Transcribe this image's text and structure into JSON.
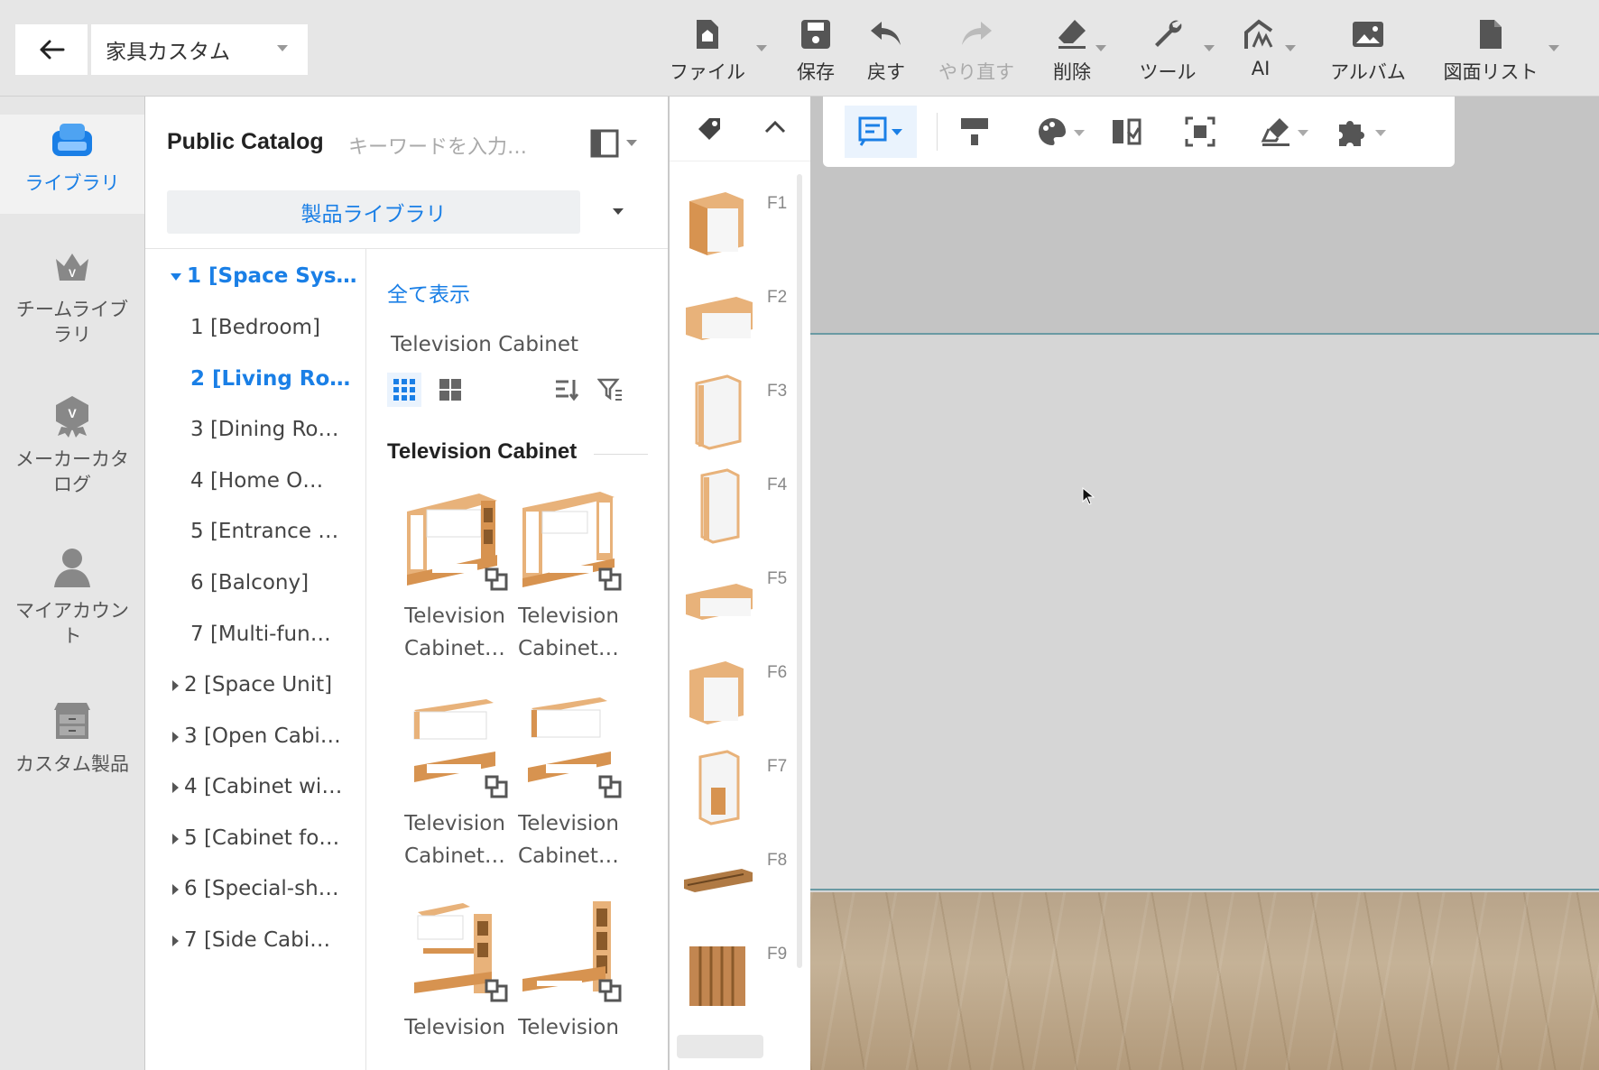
{
  "topbar": {
    "mode": "家具カスタム",
    "tools": [
      {
        "label": "ファイル",
        "icon": "file-icon"
      },
      {
        "label": "保存",
        "icon": "save-icon"
      },
      {
        "label": "戻す",
        "icon": "undo-icon"
      },
      {
        "label": "やり直す",
        "icon": "redo-icon"
      },
      {
        "label": "削除",
        "icon": "eraser-icon"
      },
      {
        "label": "ツール",
        "icon": "wrench-icon"
      },
      {
        "label": "AI",
        "icon": "ai-icon"
      },
      {
        "label": "アルバム",
        "icon": "album-icon"
      },
      {
        "label": "図面リスト",
        "icon": "drawing-list-icon"
      }
    ]
  },
  "rail": {
    "items": [
      {
        "label": "ライブラリ",
        "icon": "sofa-icon"
      },
      {
        "label": "チームライブラリ",
        "icon": "crown-icon"
      },
      {
        "label": "メーカーカタログ",
        "icon": "badge-icon"
      },
      {
        "label": "マイアカウント",
        "icon": "user-icon"
      },
      {
        "label": "カスタム製品",
        "icon": "cabinet-icon"
      }
    ]
  },
  "catalog": {
    "title": "Public Catalog",
    "search_placeholder": "キーワードを入力…",
    "library": "製品ライブラリ",
    "tree": [
      "1 [Space Sys…",
      "1 [Bedroom]",
      "2 [Living Ro…",
      "3 [Dining Ro…",
      "4 [Home O…",
      "5 [Entrance …",
      "6 [Balcony]",
      "7 [Multi-fun…",
      "2 [Space Unit]",
      "3 [Open Cabi…",
      "4 [Cabinet wi…",
      "5 [Cabinet fo…",
      "6 [Special-sh…",
      "7 [Side Cabi…"
    ],
    "show_all": "全て表示",
    "breadcrumb": "Television Cabinet",
    "section_title": "Television Cabinet",
    "products": [
      {
        "line1": "Television",
        "line2": "Cabinet…"
      },
      {
        "line1": "Television",
        "line2": "Cabinet…"
      },
      {
        "line1": "Television",
        "line2": "Cabinet…"
      },
      {
        "line1": "Television",
        "line2": "Cabinet…"
      },
      {
        "line1": "Television",
        "line2": ""
      },
      {
        "line1": "Television",
        "line2": ""
      }
    ]
  },
  "thumbs": {
    "labels": [
      "F1",
      "F2",
      "F3",
      "F4",
      "F5",
      "F6",
      "F7",
      "F8",
      "F9"
    ]
  },
  "colors": {
    "accent": "#1a7fe6",
    "wood": "#d9a362",
    "panel": "#ffffff"
  }
}
